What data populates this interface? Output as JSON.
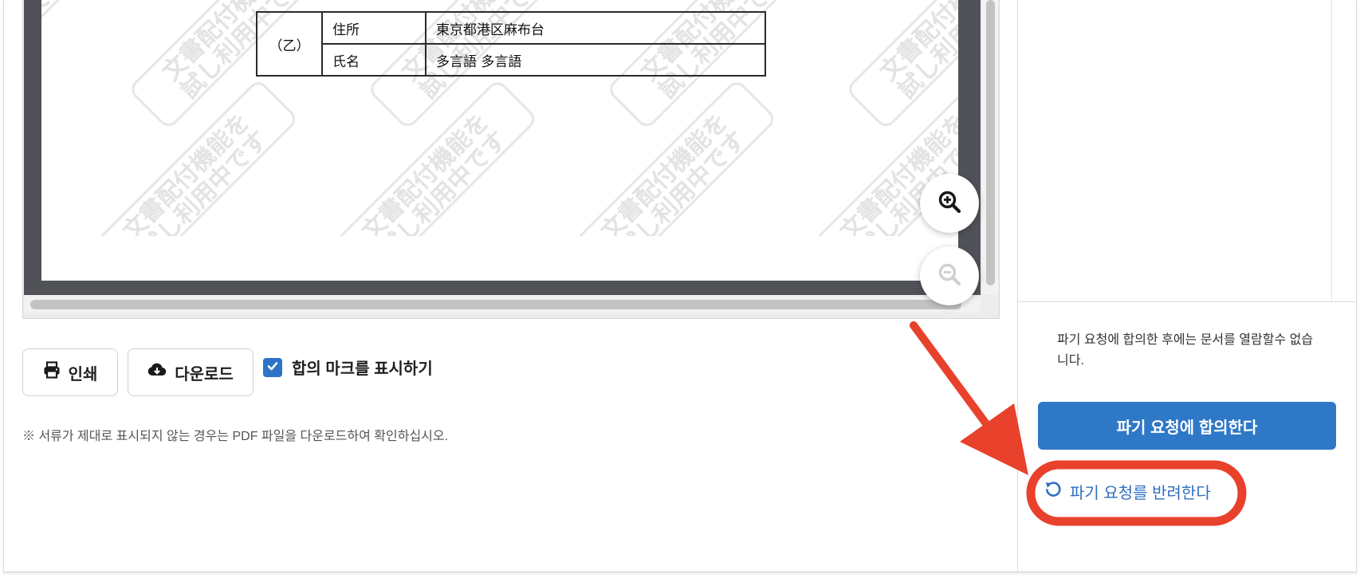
{
  "document": {
    "table": {
      "party": "（乙）",
      "rows": [
        {
          "label": "住所",
          "value": "東京都港区麻布台"
        },
        {
          "label": "氏名",
          "value": "多言語  多言語"
        }
      ]
    },
    "watermark": {
      "line1": "文書配付機能を",
      "line2": "試し利用中です"
    }
  },
  "zoom": {
    "zoom_in_icon": "zoom-in-icon",
    "zoom_out_icon": "zoom-out-icon",
    "zoom_out_enabled": false
  },
  "actions": {
    "print_label": "인쇄",
    "download_label": "다운로드",
    "show_agreement_mark_label": "합의 마크를 표시하기",
    "show_agreement_mark_checked": true
  },
  "note": "※ 서류가 제대로 표시되지 않는 경우는 PDF 파일을 다운로드하여 확인하십시오.",
  "side_panel": {
    "info_text": "파기 요청에 합의한 후에는 문서를 열람할수 없습니다.",
    "agree_button_label": "파기 요청에 합의한다",
    "reject_button_label": "파기 요청를 반려한다"
  },
  "colors": {
    "primary": "#2e78c7",
    "link": "#2e6fbf",
    "annotation": "#e8412c",
    "checkbox": "#2c74c6"
  }
}
